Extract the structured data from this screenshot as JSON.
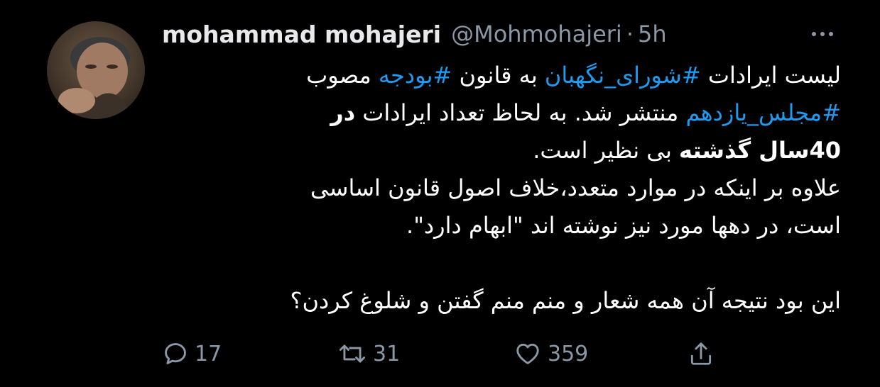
{
  "tweet": {
    "author_name": "mohammad mohajeri",
    "handle": "@Mohmohajeri",
    "separator": "·",
    "time": "5h",
    "lines": [
      [
        {
          "t": "لیست ایرادات ",
          "style": "plain"
        },
        {
          "t": "#شورای_نگهبان",
          "style": "hashtag"
        },
        {
          "t": " به قانون ",
          "style": "plain"
        },
        {
          "t": "#بودجه",
          "style": "hashtag"
        },
        {
          "t": " مصوب",
          "style": "plain"
        }
      ],
      [
        {
          "t": "#مجلس_یازدهم",
          "style": "hashtag"
        },
        {
          "t": " منتشر شد. به لحاظ تعداد ایرادات ",
          "style": "plain"
        },
        {
          "t": "در",
          "style": "bold"
        }
      ],
      [
        {
          "t": "40سال گذشته",
          "style": "bold"
        },
        {
          "t": " بی نظیر است.",
          "style": "plain"
        }
      ],
      [
        {
          "t": "علاوه بر اینکه در موارد متعدد،خلاف اصول قانون اساسی",
          "style": "plain"
        }
      ],
      [
        {
          "t": "است، در دهها مورد نیز نوشته اند \"ابهام دارد\".",
          "style": "plain"
        }
      ],
      [],
      [
        {
          "t": "این بود نتیجه آن همه شعار و منم منم گفتن و شلوغ کردن؟",
          "style": "plain"
        }
      ]
    ]
  },
  "actions": {
    "reply": {
      "icon": "reply-icon",
      "count": "17"
    },
    "retweet": {
      "icon": "retweet-icon",
      "count": "31"
    },
    "like": {
      "icon": "heart-icon",
      "count": "359"
    },
    "share": {
      "icon": "share-icon"
    }
  },
  "colors": {
    "background": "#000000",
    "text": "#ffffff",
    "secondary": "#8b98a5",
    "link": "#1d9bf0"
  }
}
